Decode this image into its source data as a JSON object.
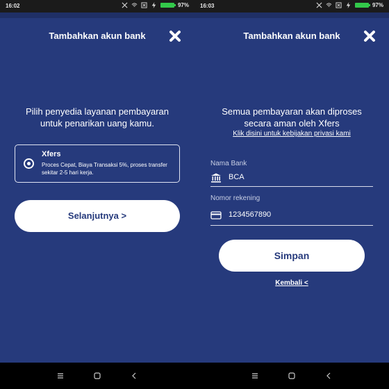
{
  "left": {
    "status_time": "16:02",
    "battery_pct": "97%",
    "title": "Tambahkan akun bank",
    "prompt_line1": "Pilih penyedia layanan pembayaran",
    "prompt_line2": "untuk penarikan uang kamu.",
    "provider": {
      "name": "Xfers",
      "description": "Proces Cepat, Biaya Transaksi 5%, proses transfer sekitar 2-5 hari kerja.",
      "selected": true
    },
    "next_label": "Selanjutnya >"
  },
  "right": {
    "status_time": "16:03",
    "battery_pct": "97%",
    "title": "Tambahkan akun bank",
    "info_line1": "Semua pembayaran akan diproses",
    "info_line2": "secara aman oleh Xfers",
    "privacy_link": "Klik disini untuk kebijakan privasi kami",
    "bank_label": "Nama Bank",
    "bank_value": "BCA",
    "account_label": "Nomor rekening",
    "account_value": "1234567890",
    "save_label": "Simpan",
    "back_label": "Kembali <"
  },
  "colors": {
    "background": "#263a7c",
    "button": "#ffffff",
    "button_text": "#263a7c",
    "battery": "#32c84a"
  },
  "icons": [
    "close-icon",
    "radio-icon",
    "bank-icon",
    "card-icon",
    "menu-icon",
    "home-icon",
    "back-icon",
    "signal-icon",
    "wifi-icon",
    "sim-icon",
    "charging-icon"
  ]
}
